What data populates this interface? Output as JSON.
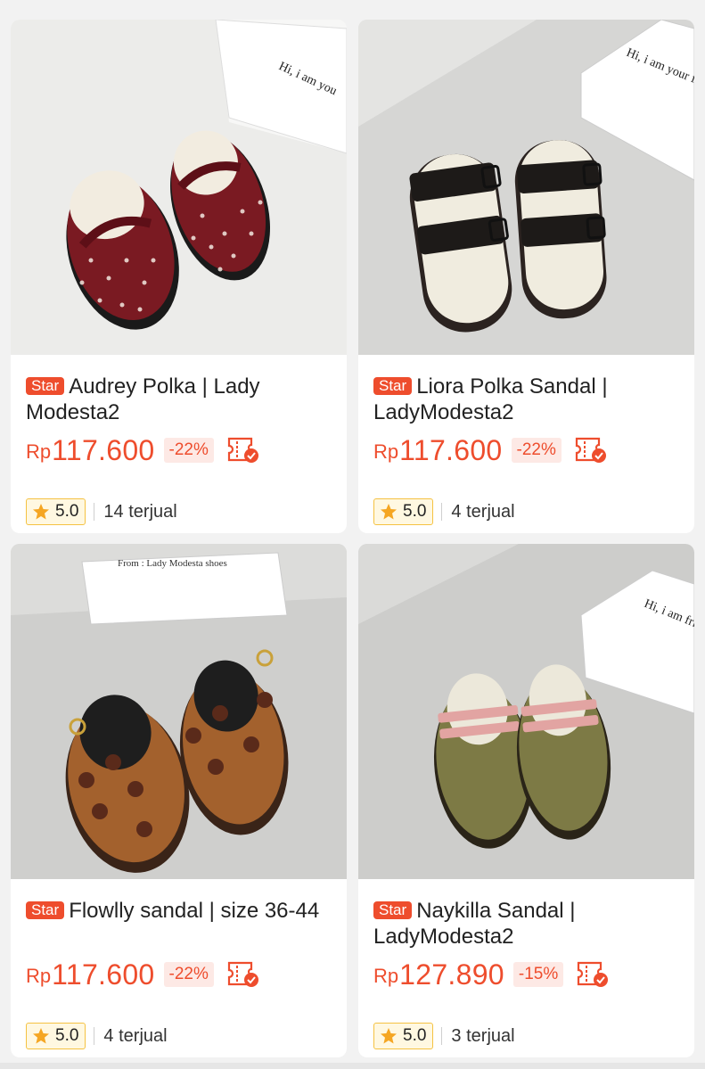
{
  "products": [
    {
      "badge": "Star",
      "title": "Audrey Polka | Lady Modesta2",
      "currency": "Rp",
      "price": "117.600",
      "discount": "-22%",
      "rating": "5.0",
      "sold": "14 terjual",
      "image": "burgundy polka dot clog mules with bow, on white background with box",
      "box_text": "Hi, i am you"
    },
    {
      "badge": "Star",
      "title": "Liora Polka Sandal | LadyModesta2",
      "currency": "Rp",
      "price": "117.600",
      "discount": "-22%",
      "rating": "5.0",
      "sold": "4 terjual",
      "image": "black polka two-strap sandals with cream footbed",
      "box_text": "Hi, i am your friend!"
    },
    {
      "badge": "Star",
      "title": "Flowlly sandal | size 36-44",
      "currency": "Rp",
      "price": "117.600",
      "discount": "-22%",
      "rating": "5.0",
      "sold": "4 terjual",
      "image": "brown suede clogs with flower appliques",
      "box_text": "From : Lady Modesta shoes"
    },
    {
      "badge": "Star",
      "title": "Naykilla Sandal | LadyModesta2",
      "currency": "Rp",
      "price": "127.890",
      "discount": "-15%",
      "rating": "5.0",
      "sold": "3 terjual",
      "image": "olive suede clogs with pink double straps",
      "box_text": "Hi, i am friend!"
    }
  ],
  "colors": {
    "accent": "#ee4d2d",
    "discount_bg": "#fde9e5",
    "rating_bg": "#fff8e1",
    "star": "#f5a623"
  },
  "icons": [
    "star-icon",
    "voucher-icon"
  ]
}
